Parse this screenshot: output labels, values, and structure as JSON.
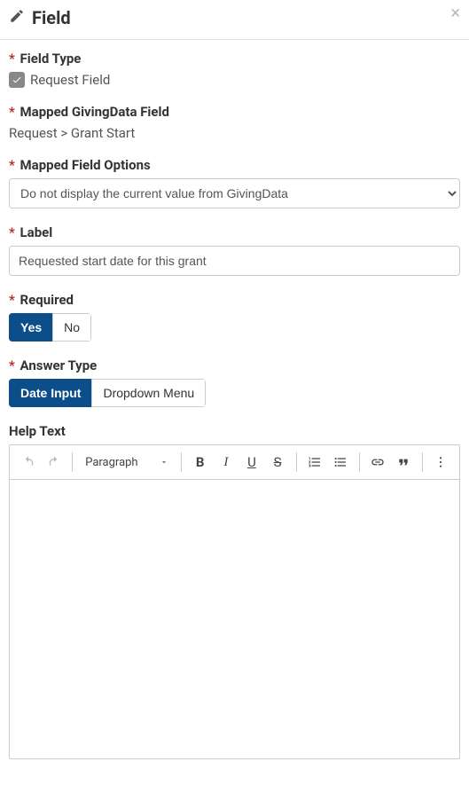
{
  "header": {
    "title": "Field"
  },
  "fieldType": {
    "label": "Field Type",
    "checkboxLabel": "Request Field",
    "checked": true
  },
  "mappedField": {
    "label": "Mapped GivingData Field",
    "value": "Request > Grant Start"
  },
  "mappedOptions": {
    "label": "Mapped Field Options",
    "selected": "Do not display the current value from GivingData"
  },
  "labelField": {
    "label": "Label",
    "value": "Requested start date for this grant"
  },
  "required": {
    "label": "Required",
    "options": [
      "Yes",
      "No"
    ],
    "active": 0
  },
  "answerType": {
    "label": "Answer Type",
    "options": [
      "Date Input",
      "Dropdown Menu"
    ],
    "active": 0
  },
  "helpText": {
    "label": "Help Text",
    "paragraphLabel": "Paragraph"
  }
}
